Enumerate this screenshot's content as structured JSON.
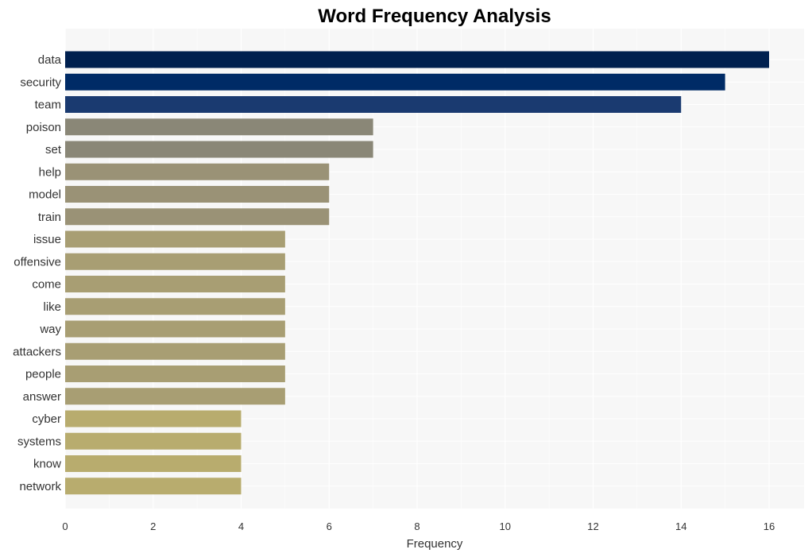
{
  "chart_data": {
    "type": "bar",
    "orientation": "horizontal",
    "title": "Word Frequency Analysis",
    "xlabel": "Frequency",
    "ylabel": "",
    "xlim": [
      0,
      16.8
    ],
    "xticks": [
      0,
      2,
      4,
      6,
      8,
      10,
      12,
      14,
      16
    ],
    "grid": true,
    "categories": [
      "data",
      "security",
      "team",
      "poison",
      "set",
      "help",
      "model",
      "train",
      "issue",
      "offensive",
      "come",
      "like",
      "way",
      "attackers",
      "people",
      "answer",
      "cyber",
      "systems",
      "know",
      "network"
    ],
    "values": [
      16,
      15,
      14,
      7,
      7,
      6,
      6,
      6,
      5,
      5,
      5,
      5,
      5,
      5,
      5,
      5,
      4,
      4,
      4,
      4
    ],
    "colors": [
      "#00204f",
      "#002b66",
      "#1a3a70",
      "#8a8777",
      "#8a8777",
      "#9a9276",
      "#9a9276",
      "#9a9276",
      "#a89e73",
      "#a89e73",
      "#a89e73",
      "#a89e73",
      "#a89e73",
      "#a89e73",
      "#a89e73",
      "#a89e73",
      "#b8ac6e",
      "#b8ac6e",
      "#b8ac6e",
      "#b8ac6e"
    ],
    "background": "#f7f7f7"
  }
}
